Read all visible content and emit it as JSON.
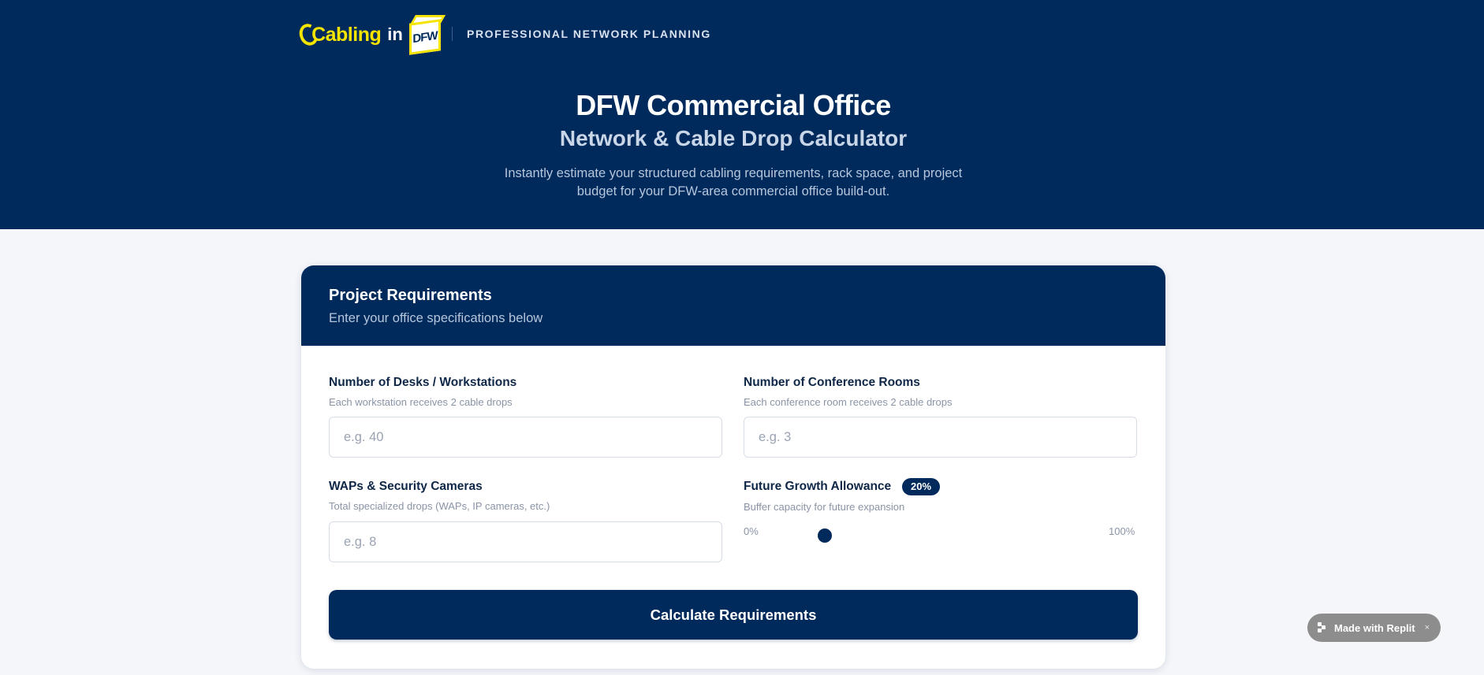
{
  "header": {
    "logo": {
      "primary": "Cabling",
      "connector": "in",
      "cube": "DFW"
    },
    "tagline": "PROFESSIONAL NETWORK PLANNING",
    "title": "DFW Commercial Office",
    "subtitle": "Network & Cable Drop Calculator",
    "description": "Instantly estimate your structured cabling requirements, rack space, and project budget for your DFW-area commercial office build-out."
  },
  "form": {
    "title": "Project Requirements",
    "subtitle": "Enter your office specifications below",
    "fields": {
      "desks": {
        "label": "Number of Desks / Workstations",
        "help": "Each workstation receives 2 cable drops",
        "placeholder": "e.g. 40",
        "value": ""
      },
      "conference": {
        "label": "Number of Conference Rooms",
        "help": "Each conference room receives 2 cable drops",
        "placeholder": "e.g. 3",
        "value": ""
      },
      "waps": {
        "label": "WAPs & Security Cameras",
        "help": "Total specialized drops (WAPs, IP cameras, etc.)",
        "placeholder": "e.g. 8",
        "value": ""
      },
      "growth": {
        "label": "Future Growth Allowance",
        "badge": "20%",
        "help": "Buffer capacity for future expansion",
        "min_label": "0%",
        "max_label": "100%",
        "value_percent": 20
      }
    },
    "submit_label": "Calculate Requirements"
  },
  "replit_badge": {
    "label": "Made with Replit",
    "close": "×"
  },
  "colors": {
    "navy": "#002a5c",
    "logo_yellow": "#f5e400",
    "page_bg": "#f4f6fa"
  }
}
